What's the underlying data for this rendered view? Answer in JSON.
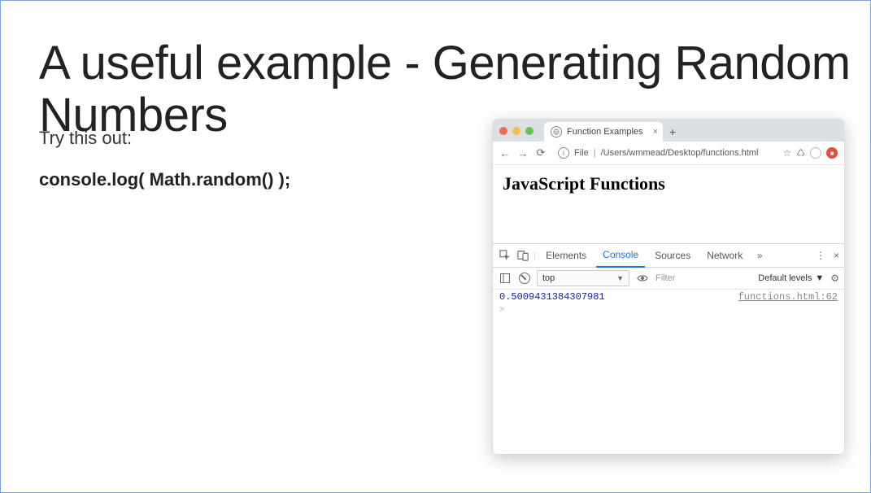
{
  "slide": {
    "title": "A useful example - Generating Random Numbers",
    "subtitle": "Try this out:",
    "code": "console.log( Math.random() );"
  },
  "browser": {
    "tab_title": "Function Examples",
    "url_scheme": "File",
    "url_path": "/Users/wmmead/Desktop/functions.html",
    "page_heading": "JavaScript Functions"
  },
  "devtools": {
    "tabs": [
      "Elements",
      "Console",
      "Sources",
      "Network"
    ],
    "active_tab": "Console",
    "context": "top",
    "filter_placeholder": "Filter",
    "levels_label": "Default levels",
    "log_value": "0.5009431384307981",
    "log_source": "functions.html:62",
    "prompt": ">"
  }
}
